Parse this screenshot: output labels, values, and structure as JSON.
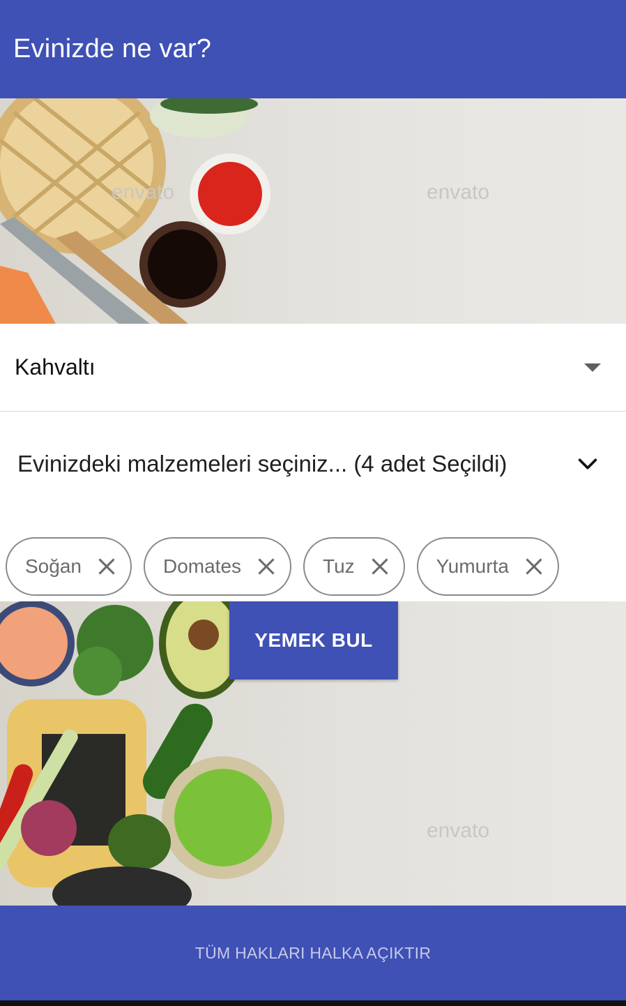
{
  "appbar": {
    "title": "Evinizde ne var?"
  },
  "hero": {
    "watermark": "envato"
  },
  "meal_spinner": {
    "selected": "Kahvaltı"
  },
  "ingredients": {
    "label": "Evinizdeki malzemeleri seçiniz... (4  adet Seçildi)",
    "chips": [
      {
        "label": "Soğan"
      },
      {
        "label": "Domates"
      },
      {
        "label": "Tuz"
      },
      {
        "label": "Yumurta"
      }
    ]
  },
  "action": {
    "find_label": "YEMEK BUL"
  },
  "footer": {
    "text": "TÜM HAKLARI HALKA AÇIKTIR"
  },
  "colors": {
    "primary": "#3f51b5",
    "footer_text": "#c6cbe9"
  },
  "icons": [
    "dropdown-arrow-icon",
    "chevron-down-icon",
    "close-icon"
  ]
}
